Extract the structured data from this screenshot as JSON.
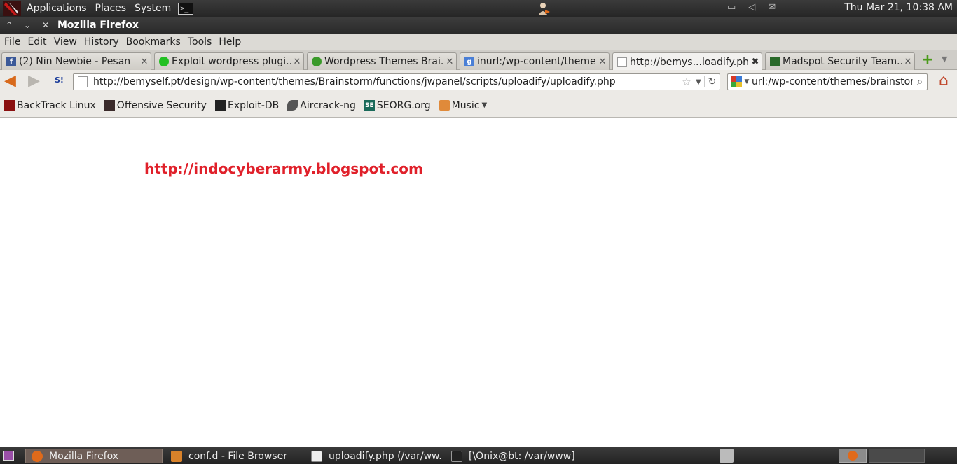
{
  "top_panel": {
    "menus": [
      "Applications",
      "Places",
      "System"
    ],
    "terminal_icon_text": ">_",
    "clock": "Thu Mar 21, 10:38 AM"
  },
  "window": {
    "title": "Mozilla Firefox"
  },
  "menubar": {
    "file": "File",
    "edit": "Edit",
    "view": "View",
    "history": "History",
    "bookmarks": "Bookmarks",
    "tools": "Tools",
    "help": "Help"
  },
  "tabs": [
    {
      "label": "(2) Nin Newbie - Pesan",
      "icon": "facebook-icon",
      "color": "#3b5998"
    },
    {
      "label": "Exploit wordpress plugi...",
      "icon": "skull-icon",
      "color": "#22c022"
    },
    {
      "label": "Wordpress Themes Brai...",
      "icon": "green-dot-icon",
      "color": "#3a9a2a"
    },
    {
      "label": "inurl:/wp-content/theme...",
      "icon": "google-icon",
      "color": "#4a7fd6"
    },
    {
      "label": "http://bemys...loadify.php",
      "icon": "page-icon",
      "color": "#ffffff",
      "active": true
    },
    {
      "label": "Madspot Security Team...",
      "icon": "madspot-icon",
      "color": "#2a6a2a"
    }
  ],
  "navbar": {
    "url": "http://bemyself.pt/design/wp-content/themes/Brainstorm/functions/jwpanel/scripts/uploadify/uploadify.php",
    "search_value": "url:/wp-content/themes/brainstorm",
    "si_text": "S!"
  },
  "bookmarks": [
    {
      "label": "BackTrack Linux",
      "icon": "backtrack-icon",
      "color": "#8a1010"
    },
    {
      "label": "Offensive Security",
      "icon": "offsec-icon",
      "color": "#3a2a2a"
    },
    {
      "label": "Exploit-DB",
      "icon": "exploitdb-icon",
      "color": "#222222"
    },
    {
      "label": "Aircrack-ng",
      "icon": "aircrack-icon",
      "color": "#555555"
    },
    {
      "label": "SEORG.org",
      "icon": "seorg-icon",
      "color": "#1a6a5a",
      "text": "SE"
    },
    {
      "label": "Music",
      "icon": "folder-icon",
      "color": "#e08a3a",
      "folder": true
    }
  ],
  "content": {
    "link_text": "http://indocyberarmy.blogspot.com",
    "link_color": "#e0202a"
  },
  "taskbar": [
    {
      "label": "Mozilla Firefox",
      "icon": "firefox-icon",
      "active": true
    },
    {
      "label": "conf.d - File Browser",
      "icon": "folder-icon"
    },
    {
      "label": "uploadify.php (/var/ww...",
      "icon": "text-editor-icon"
    },
    {
      "label": "[\\Onix@bt: /var/www]",
      "icon": "terminal-icon"
    }
  ]
}
